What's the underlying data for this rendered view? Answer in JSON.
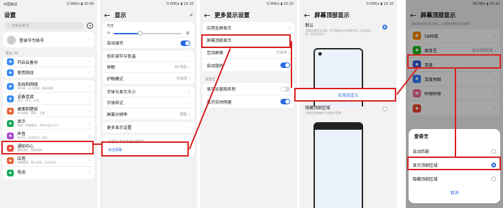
{
  "status": {
    "p1": {
      "left": "中国移动",
      "right": "0.00K/s",
      "time": "15:09"
    },
    "p2": {
      "left": "",
      "right": "0.00K/s",
      "time": "15:10"
    },
    "p3": {
      "left": "",
      "right": "0.00K/s",
      "time": "15:10"
    },
    "p4": {
      "left": "",
      "right": "0.00K/s",
      "time": "15:10"
    },
    "p5": {
      "left": "",
      "right": "34.0B/s",
      "time": "15:10"
    }
  },
  "p1": {
    "title": "设置",
    "search_placeholder": "搜索设置项",
    "account": "登录华为帐号",
    "account_sub": "",
    "suggest": "建议 (4)",
    "items": [
      {
        "label": "开启云备份",
        "sub": "",
        "icon": "cloud-icon",
        "color": "#3b8cf2"
      },
      {
        "label": "使用指纹",
        "sub": "",
        "icon": "fingerprint-icon",
        "color": "#3b8cf2"
      }
    ],
    "items2": [
      {
        "label": "无线和网络",
        "sub": "WLAN、双卡管理、移动网络",
        "icon": "wifi-icon",
        "color": "#3b8cf2"
      },
      {
        "label": "设备连接",
        "sub": "蓝牙、NFC、打印",
        "icon": "device-icon",
        "color": "#3b8cf2"
      },
      {
        "label": "桌面和壁纸",
        "sub": "杂志锁屏、壁纸、主题",
        "icon": "wallpaper-icon",
        "color": "#e8663a"
      },
      {
        "label": "显示",
        "sub": "亮度、护眼模式、字体与显示大小",
        "icon": "display-icon",
        "color": "#1aa85a"
      },
      {
        "label": "声音",
        "sub": "免打扰、来电铃声、振动",
        "icon": "sound-icon",
        "color": "#a94bd0"
      },
      {
        "label": "通知中心",
        "sub": "图标角标、锁屏通知",
        "icon": "notification-icon",
        "color": "#e84c3d"
      },
      {
        "label": "应用",
        "sub": "权限管理、默认应用、应用分身",
        "icon": "apps-icon",
        "color": "#e8663a"
      },
      {
        "label": "电池",
        "sub": "",
        "icon": "battery-icon",
        "color": "#1aa85a"
      }
    ]
  },
  "p2": {
    "title": "显示",
    "brightness": "亮度",
    "auto": "自动调节",
    "rows": [
      {
        "label": "色彩调节与色温",
        "right": ""
      },
      {
        "label": "休眠",
        "right": "30 秒后"
      },
      {
        "label": "护眼模式",
        "right": "已关闭"
      }
    ],
    "rows2": [
      {
        "label": "字体与显示大小",
        "right": ""
      },
      {
        "label": "字体样式",
        "right": ""
      },
      {
        "label": "屏幕分辨率",
        "right": "智能"
      }
    ],
    "more": "更多显示设置",
    "tip": "是否在寻找其他设置项？",
    "tip_link": "双击屏幕"
  },
  "p3": {
    "title": "更多显示设置",
    "rows": [
      {
        "label": "应用全屏显示",
        "right": ""
      },
      {
        "label": "屏幕顶部显示",
        "right": ""
      },
      {
        "label": "互动屏保",
        "right": "已关闭"
      },
      {
        "label": "自动旋转",
        "right": ""
      }
    ],
    "section": "状态栏",
    "rows2": [
      {
        "label": "显示运营商名称"
      },
      {
        "label": "显示实时网速"
      }
    ]
  },
  "p4": {
    "title": "屏幕顶部显示",
    "default": "默认",
    "default_sub": "顶部区域显示内容，开可能炫显示屏幕空间，后台运行时，用应用显示",
    "apply": "应用自定义",
    "hide": "隐藏顶部区域",
    "hide_sub": "顶部区域将被作为状态栏背景"
  },
  "p5": {
    "title": "屏幕顶部显示",
    "desc": "请选择应用的显示模式，以便获得最佳显示效果",
    "apps": [
      {
        "name": "58同城",
        "right": "",
        "color": "#ff8a00",
        "icon": "58-icon"
      },
      {
        "name": "爱奇艺",
        "right": "显示顶部区域",
        "color": "#20c020",
        "icon": "iqiyi-icon"
      },
      {
        "name": "百度",
        "right": "",
        "color": "#2f5fe0",
        "icon": "baidu-icon"
      },
      {
        "name": "百度地图",
        "right": "",
        "color": "#2f80ff",
        "icon": "baidu-map-icon"
      },
      {
        "name": "哔哩哔哩",
        "right": "",
        "color": "#f36f9a",
        "icon": "bilibili-icon"
      },
      {
        "name": "",
        "right": "",
        "color": "#f0422a",
        "icon": "app-icon"
      }
    ],
    "dialog": {
      "title": "爱奇艺",
      "options": [
        "自动匹配",
        "显示顶部区域",
        "隐藏顶部区域"
      ],
      "selected": 1,
      "cancel": "取消"
    }
  }
}
